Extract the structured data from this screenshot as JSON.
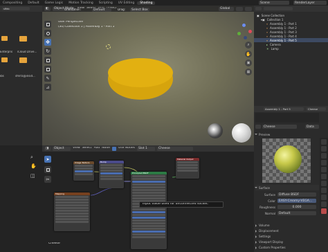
{
  "topbar": {
    "tabs": [
      "Compositing",
      "Default",
      "Game Logic",
      "Motion Tracking",
      "Scripting",
      "UV Editing",
      "Shading"
    ],
    "active_tab": "Shading",
    "scene_label": "Scene",
    "render_layer": "RenderLayer",
    "options_label": "Options"
  },
  "filebrowser": {
    "path_field": "sffeb",
    "items": [
      "Enterpris",
      "iCloud Drive...",
      "ibs",
      "sferra@insid..."
    ]
  },
  "viewport": {
    "mode": "Object Mode",
    "menus": [
      "View",
      "Select",
      "Add",
      "Object"
    ],
    "orientation_label": "Orientation:",
    "orientation_value": "Default",
    "drag_label": "Drag:",
    "drag_value": "Select Box",
    "transform": "Global",
    "info_line1": "User Perspective",
    "info_line2": "(30) Collection 1 | Assembly 1 - Part 5",
    "colors": {
      "disc": "#e2b011",
      "background": "#6b6a55"
    }
  },
  "nodes": {
    "object_label": "Object",
    "menus": [
      "View",
      "Select",
      "Add",
      "Node"
    ],
    "use_nodes_label": "Use Nodes",
    "slot_label": "Slot 1",
    "material_name": "Cheese",
    "tooltip": "Input value used for unconnected socket.",
    "footer_label": "Cheese",
    "node_titles": [
      "Image Texture",
      "Bump",
      "Principled BSDF",
      "Material Output",
      "Mapping"
    ]
  },
  "outliner": {
    "title": "Scene Collection",
    "rows": [
      {
        "label": "Collection 1",
        "level": 1
      },
      {
        "label": "Assembly 1 - Part 1",
        "level": 2
      },
      {
        "label": "Assembly 1 - Part 2",
        "level": 2
      },
      {
        "label": "Assembly 1 - Part 3",
        "level": 2
      },
      {
        "label": "Assembly 1 - Part 4",
        "level": 2
      },
      {
        "label": "Assembly 1 - Part 5",
        "level": 2
      },
      {
        "label": "Camera",
        "level": 1
      },
      {
        "label": "Lamp",
        "level": 1
      }
    ]
  },
  "properties": {
    "object_name": "Assembly 1 - Part 5",
    "material_tag": "Cheese",
    "material_name": "Cheese",
    "data_label": "Data",
    "preview_label": "Preview",
    "surface_label": "Surface",
    "surface_field_label": "Surface",
    "surface_value": "Diffuse BSDF",
    "color_label": "Color",
    "color_value": "EASY-Creamy-VEGA...",
    "roughness_label": "Roughness",
    "roughness_value": "0.000",
    "normal_label": "Normal",
    "normal_value": "Default",
    "sections": [
      "Volume",
      "Displacement",
      "Settings",
      "Viewport Display",
      "Custom Properties"
    ]
  }
}
